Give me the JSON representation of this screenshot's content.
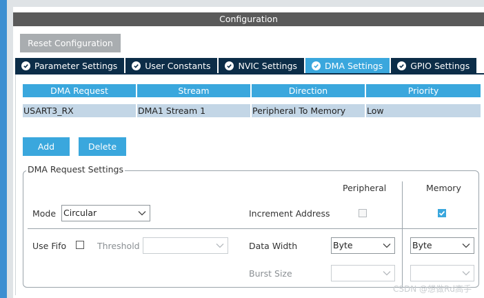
{
  "header": {
    "title": "Configuration",
    "reset_label": "Reset Configuration"
  },
  "tabs": [
    {
      "label": "Parameter Settings",
      "active": false
    },
    {
      "label": "User Constants",
      "active": false
    },
    {
      "label": "NVIC Settings",
      "active": false
    },
    {
      "label": "DMA Settings",
      "active": true
    },
    {
      "label": "GPIO Settings",
      "active": false
    }
  ],
  "dma_table": {
    "columns": [
      "DMA Request",
      "Stream",
      "Direction",
      "Priority"
    ],
    "rows": [
      [
        "USART3_RX",
        "DMA1 Stream 1",
        "Peripheral To Memory",
        "Low"
      ]
    ]
  },
  "actions": {
    "add_label": "Add",
    "delete_label": "Delete"
  },
  "request_settings": {
    "legend": "DMA Request Settings",
    "peripheral_header": "Peripheral",
    "memory_header": "Memory",
    "mode_label": "Mode",
    "mode_value": "Circular",
    "increment_label": "Increment Address",
    "peripheral_increment": false,
    "memory_increment": true,
    "use_fifo_label": "Use Fifo",
    "use_fifo": false,
    "threshold_label": "Threshold",
    "threshold_value": "",
    "data_width_label": "Data Width",
    "peripheral_data_width": "Byte",
    "memory_data_width": "Byte",
    "burst_size_label": "Burst Size",
    "peripheral_burst_size": "",
    "memory_burst_size": ""
  },
  "watermark": "CSDN @想做Rd高手",
  "colors": {
    "accent": "#3aa7dd",
    "tab_dark": "#0c2d48",
    "header_bar": "#5a5a5a",
    "row_bg": "#c3d6e6"
  }
}
